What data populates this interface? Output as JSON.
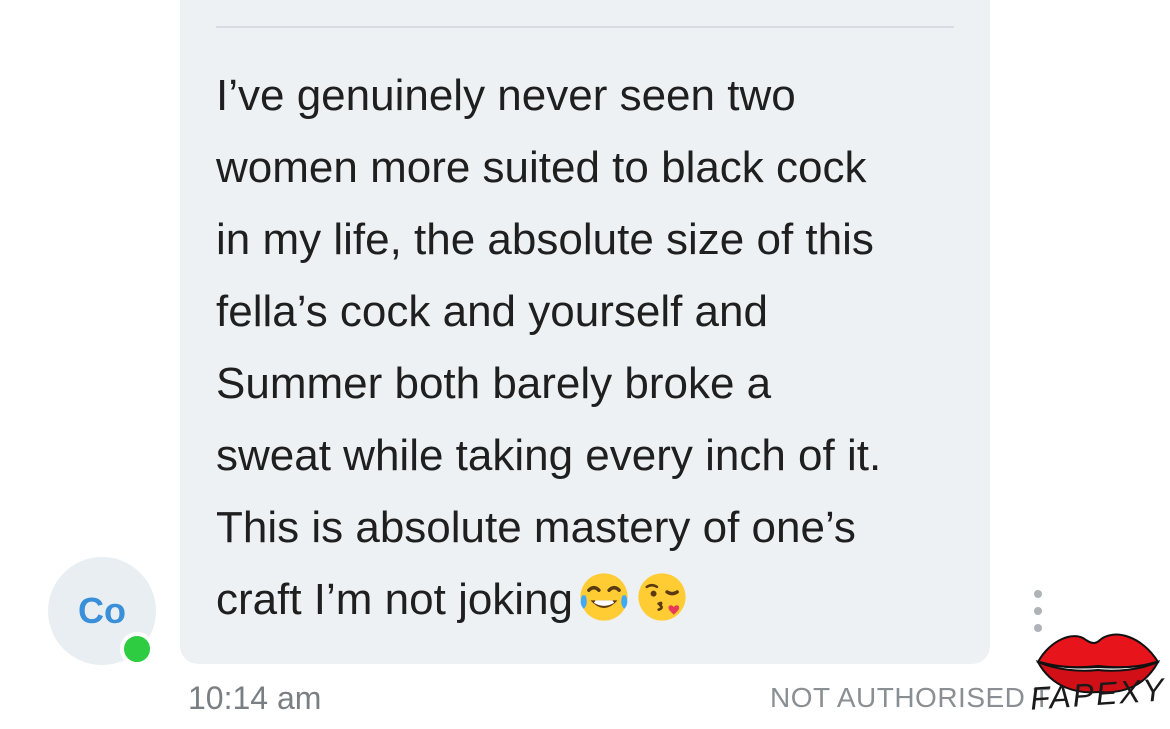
{
  "message": {
    "text": "I’ve genuinely never seen two\nwomen more suited to black cock\nin my life, the absolute size of this\nfella’s cock and yourself and\nSummer both barely broke a\nsweat while taking every inch of it.\nThis is absolute mastery of one’s\ncraft I’m not joking",
    "emojis": [
      "tears-of-joy-emoji",
      "face-blowing-kiss-emoji"
    ],
    "timestamp": "10:14 am"
  },
  "sender": {
    "initials": "Co",
    "online": true,
    "status_color": "#2ecc40"
  },
  "watermark": {
    "text": "NOT AUTHORISED T",
    "logo_text": "FAPEXY",
    "logo_color": "#e8141c"
  },
  "colors": {
    "bubble": "#eef1f3",
    "avatar_text": "#3a8fd9"
  },
  "icons": {
    "more": "more-vertical-icon"
  }
}
